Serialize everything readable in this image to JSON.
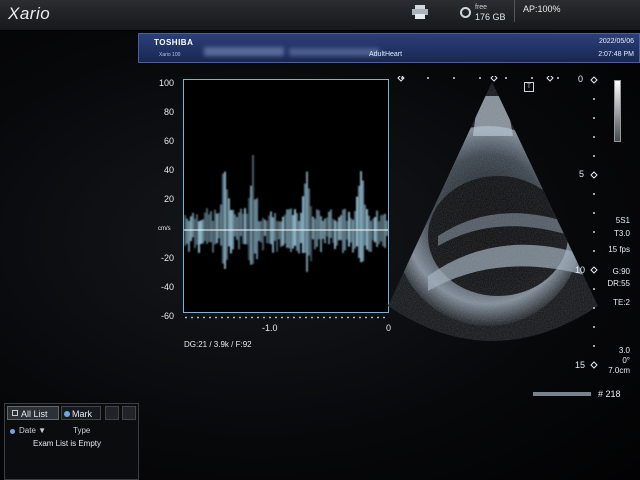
{
  "topbar": {
    "logo": "Xario",
    "disk_free_label": "free",
    "disk_free_value": "176 GB",
    "ap_status": "AP:100%"
  },
  "banner": {
    "manufacturer": "TOSHIBA",
    "model": "Xario 100",
    "exam_type": "AdultHeart",
    "date": "2022/05/06",
    "time": "2:07:48 PM"
  },
  "doppler": {
    "y_ticks": [
      "100",
      "80",
      "60",
      "40",
      "20",
      "cm/s",
      "-20",
      "-40",
      "-60"
    ],
    "x_ticks": [
      "-1.0",
      "0"
    ],
    "info": "DG:21  / 3.9k   / F:92"
  },
  "bmode": {
    "depth_ticks": [
      "0",
      "5",
      "10",
      "15"
    ],
    "probe": "5S1",
    "thi": "T3.0",
    "fps": "15 fps",
    "gain": "G:90",
    "dynamic_range": "DR:55",
    "te": "TE:2",
    "focus": "3.0",
    "angle": "0°",
    "depth": "7.0cm",
    "frame_number": "# 218",
    "t_marker": "T"
  },
  "exam_panel": {
    "tab_all": "All List",
    "tab_mark": "Mark",
    "col_date": "Date ▼",
    "col_type": "Type",
    "empty_message": "Exam List is Empty"
  },
  "colors": {
    "banner_blue": "#1f3068",
    "doppler_border": "#7bb2d8",
    "doppler_signal": "#a8d8f0"
  }
}
